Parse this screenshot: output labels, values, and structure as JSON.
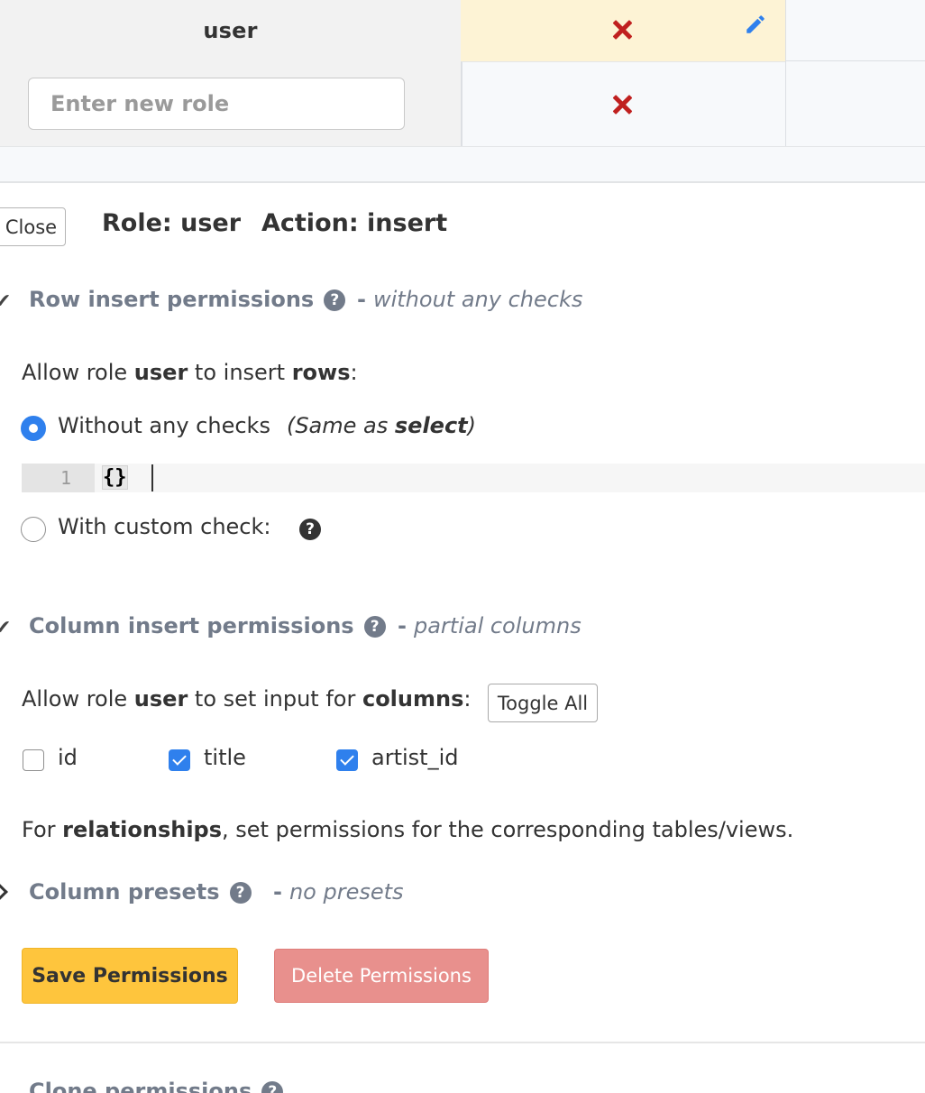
{
  "table": {
    "row_role": "user",
    "new_role_placeholder": "Enter new role"
  },
  "header": {
    "close_label": "Close",
    "role_heading": "Role: user",
    "action_heading": "Action: insert"
  },
  "row_section": {
    "title": "Row insert permissions",
    "desc_dash": "-",
    "desc": "without any checks",
    "allow_pre": "Allow role",
    "allow_role": "user",
    "allow_mid": "to insert",
    "allow_obj": "rows",
    "allow_end": ":",
    "option1_label": "Without any checks",
    "option1_note_pre": "(Same as",
    "option1_note_bold": "select",
    "option1_note_end": ")",
    "code_line_number": "1",
    "code_text": "{}",
    "option2_label": "With custom check:"
  },
  "column_section": {
    "title": "Column insert permissions",
    "desc_dash": "-",
    "desc": "partial columns",
    "allow_pre": "Allow role",
    "allow_role": "user",
    "allow_mid": "to set input for",
    "allow_obj": "columns",
    "allow_end": ":",
    "toggle_all_label": "Toggle All",
    "columns": [
      {
        "name": "id",
        "checked": false
      },
      {
        "name": "title",
        "checked": true
      },
      {
        "name": "artist_id",
        "checked": true
      }
    ],
    "rel_pre": "For",
    "rel_bold": "relationships",
    "rel_post": ", set permissions for the corresponding tables/views."
  },
  "presets_section": {
    "title": "Column presets",
    "desc_dash": "-",
    "desc": "no presets"
  },
  "actions": {
    "save_label": "Save Permissions",
    "delete_label": "Delete Permissions"
  },
  "clone_section": {
    "title": "Clone permissions"
  },
  "colors": {
    "accent_blue": "#2f80ed",
    "save_yellow": "#fec53d",
    "delete_red": "#e8908d",
    "deny_red": "#c0201f",
    "section_gray": "#727b8a"
  }
}
